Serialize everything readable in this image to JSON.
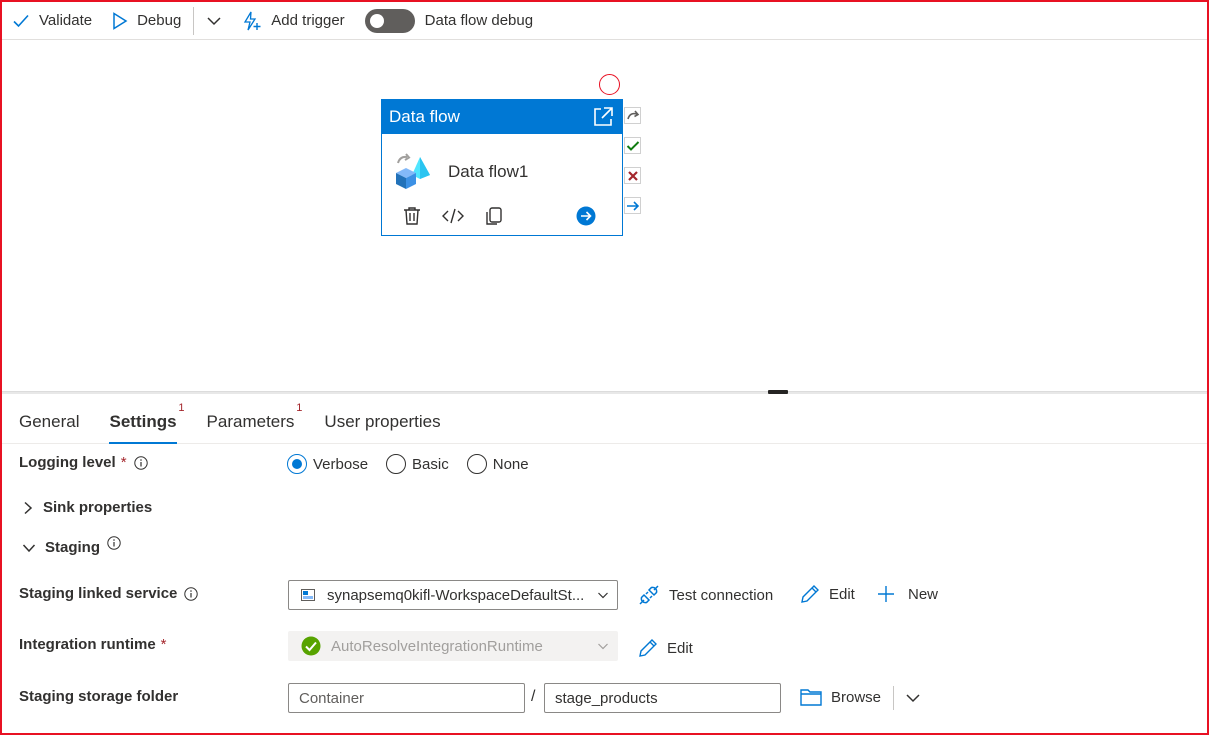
{
  "toolbar": {
    "validate": "Validate",
    "debug": "Debug",
    "add_trigger": "Add trigger",
    "dataflow_debug": "Data flow debug",
    "dataflow_debug_on": false
  },
  "activity": {
    "header": "Data flow",
    "name": "Data flow1"
  },
  "tabs": [
    {
      "label": "General",
      "badge": ""
    },
    {
      "label": "Settings",
      "badge": "1"
    },
    {
      "label": "Parameters",
      "badge": "1"
    },
    {
      "label": "User properties",
      "badge": ""
    }
  ],
  "active_tab": "Settings",
  "settings": {
    "logging_level": {
      "label": "Logging level",
      "required_mark": "*",
      "options": [
        "Verbose",
        "Basic",
        "None"
      ],
      "selected": "Verbose"
    },
    "sink_properties": "Sink properties",
    "staging": "Staging",
    "staging_linked_service": {
      "label": "Staging linked service",
      "value": "synapsemq0kifl-WorkspaceDefaultSt...",
      "test_connection": "Test connection",
      "edit": "Edit",
      "new": "New"
    },
    "integration_runtime": {
      "label": "Integration runtime",
      "required_mark": "*",
      "value": "AutoResolveIntegrationRuntime",
      "edit": "Edit"
    },
    "staging_storage_folder": {
      "label": "Staging storage folder",
      "container_placeholder": "Container",
      "separator": "/",
      "folder_value": "stage_products",
      "browse": "Browse"
    }
  },
  "colors": {
    "accent": "#0078d4",
    "error": "#a4262c",
    "success": "#107c10",
    "highlight_border": "#e81123"
  }
}
